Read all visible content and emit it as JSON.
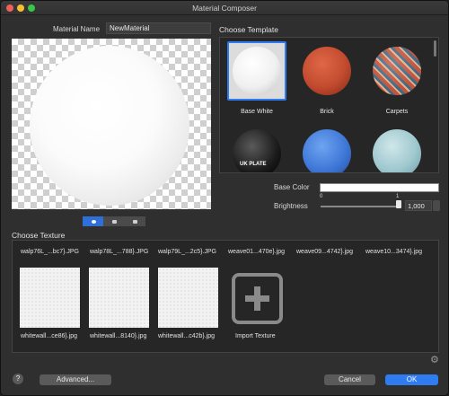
{
  "window": {
    "title": "Material Composer",
    "accent": "#2f7bf0"
  },
  "material": {
    "name_label": "Material Name",
    "name_value": "NewMaterial"
  },
  "templates": {
    "heading": "Choose Template",
    "items": [
      {
        "label": "Base White",
        "selected": true
      },
      {
        "label": "Brick",
        "selected": false
      },
      {
        "label": "Carpets",
        "selected": false
      },
      {
        "label": "",
        "selected": false,
        "overlay_text": "UK PLATE"
      },
      {
        "label": "",
        "selected": false
      },
      {
        "label": "",
        "selected": false
      }
    ]
  },
  "properties": {
    "base_color_label": "Base Color",
    "base_color_value": "#ffffff",
    "brightness_label": "Brightness",
    "brightness_min": "0",
    "brightness_max": "1",
    "brightness_value": "1,000"
  },
  "preview_modes": [
    "sphere",
    "cube",
    "plane"
  ],
  "textures": {
    "heading": "Choose Texture",
    "row1": [
      "walp76L_...bc7}.JPG",
      "walp78L_...788}.JPG",
      "walp79L_...2c5}.JPG",
      "weave01...470e}.jpg",
      "weave09...4742}.jpg",
      "weave10...3474}.jpg"
    ],
    "row2": [
      "whitewall...ce86}.jpg",
      "whitewall...8140}.jpg",
      "whitewall...c42b}.jpg"
    ],
    "import_label": "Import Texture"
  },
  "footer": {
    "help": "?",
    "advanced": "Advanced...",
    "cancel": "Cancel",
    "ok": "OK"
  }
}
